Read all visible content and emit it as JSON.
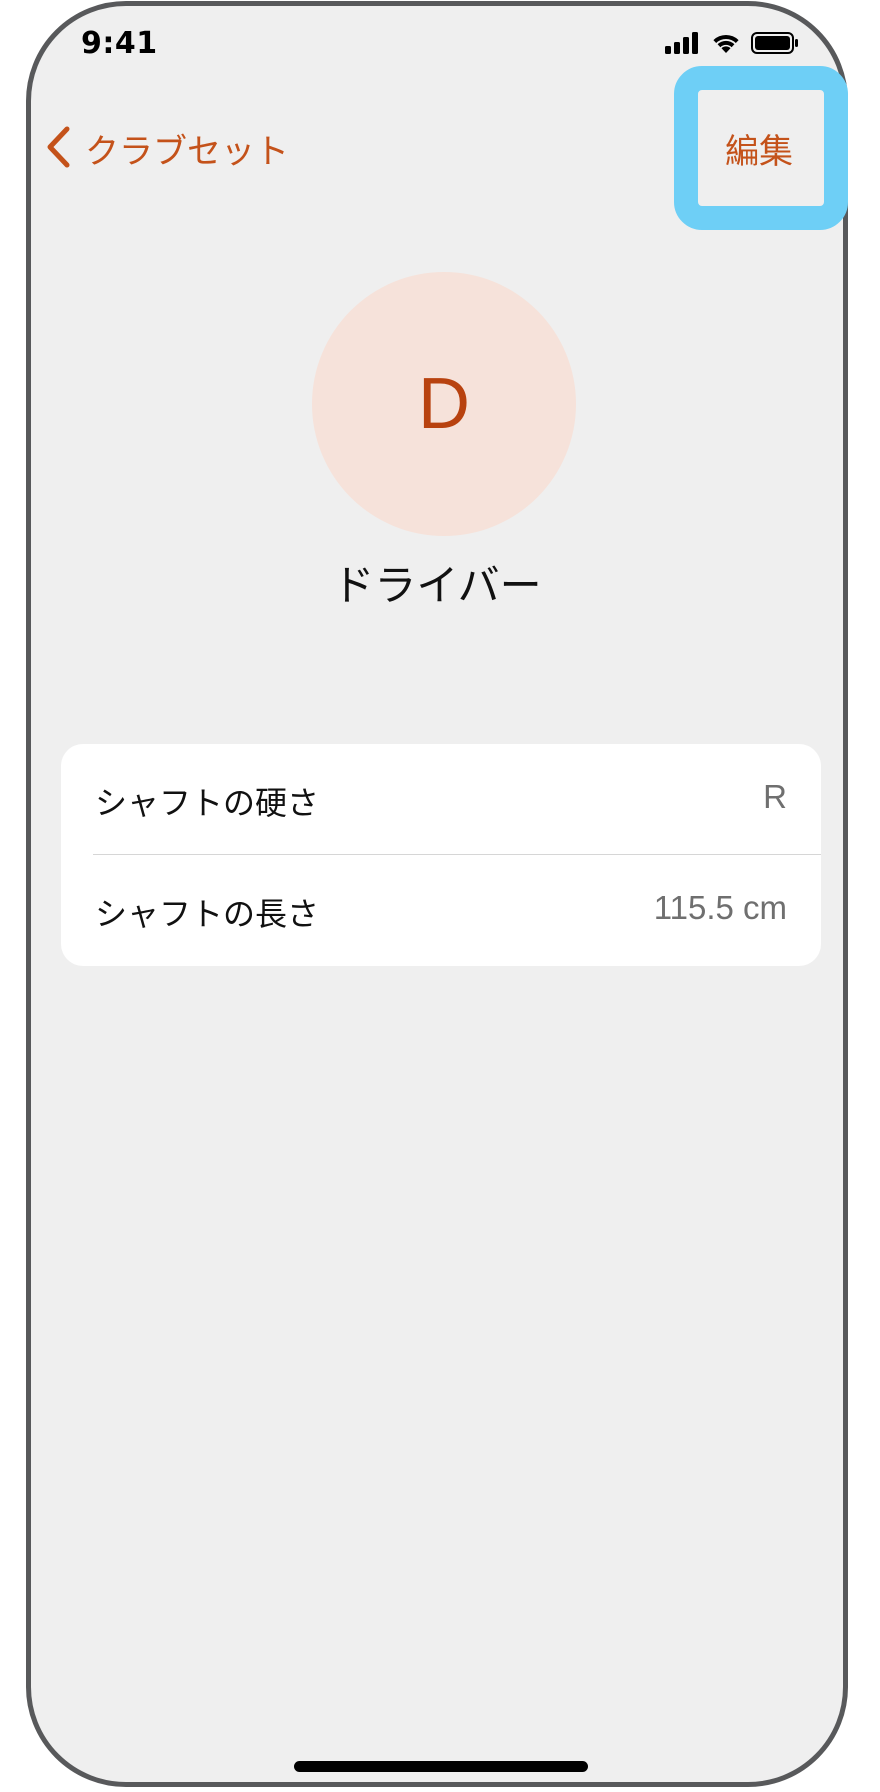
{
  "status_bar": {
    "time": "9:41",
    "icons": [
      "signal-icon",
      "wifi-icon",
      "battery-icon"
    ]
  },
  "nav": {
    "back_label": "クラブセット",
    "back_icon": "chevron-left-icon",
    "edit_label": "編集"
  },
  "club": {
    "avatar_letter": "D",
    "name": "ドライバー"
  },
  "details": [
    {
      "label": "シャフトの硬さ",
      "value": "R"
    },
    {
      "label": "シャフトの長さ",
      "value": "115.5 cm"
    }
  ],
  "colors": {
    "accent": "#c4521a",
    "avatar_bg": "#f6e2da",
    "highlight": "#6ecff6",
    "background": "#efefef"
  }
}
